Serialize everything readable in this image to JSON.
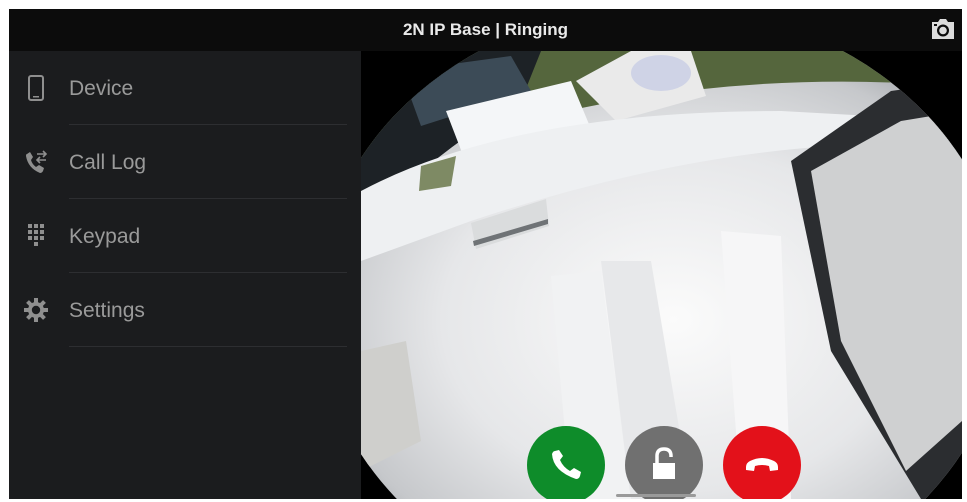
{
  "titlebar": {
    "title": "2N IP Base | Ringing",
    "camera_icon": "camera-icon"
  },
  "sidebar": {
    "items": [
      {
        "label": "Device",
        "icon": "phone-device-icon"
      },
      {
        "label": "Call Log",
        "icon": "call-log-icon"
      },
      {
        "label": "Keypad",
        "icon": "keypad-icon"
      },
      {
        "label": "Settings",
        "icon": "gear-icon"
      }
    ]
  },
  "video": {
    "feed": "intercom-camera-feed"
  },
  "call_controls": {
    "answer_icon": "phone-answer-icon",
    "unlock_icon": "padlock-open-icon",
    "hangup_icon": "phone-hangup-icon"
  },
  "colors": {
    "answer": "#0e8c2a",
    "unlock": "#707070",
    "hangup": "#e3111a",
    "sidebar_bg": "#1b1c1e",
    "title_bg": "#0c0c0c"
  }
}
